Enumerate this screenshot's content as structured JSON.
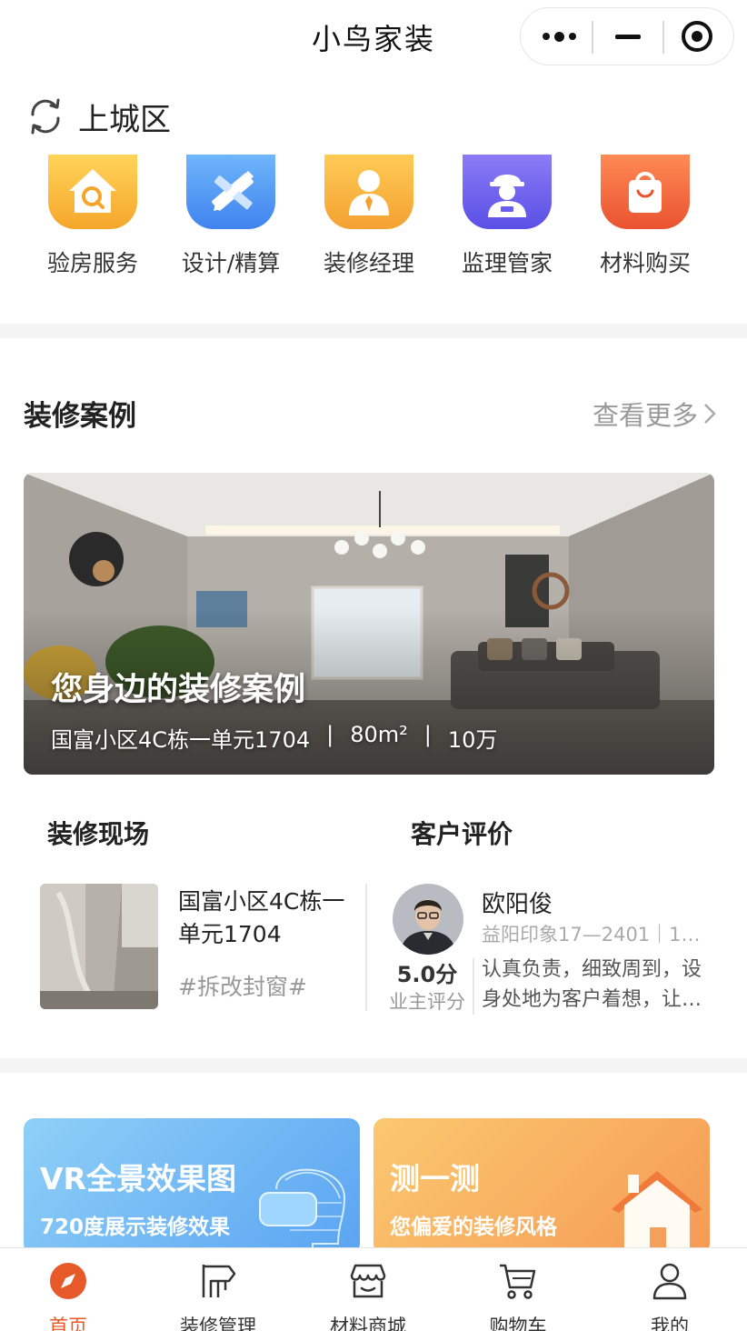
{
  "app": {
    "title": "小鸟家装"
  },
  "location": {
    "district": "上城区"
  },
  "services": [
    {
      "label": "验房服务",
      "icon": "house-search-icon",
      "color": "#f7b738"
    },
    {
      "label": "设计/精算",
      "icon": "ruler-pencil-icon",
      "color": "#4f97f3"
    },
    {
      "label": "装修经理",
      "icon": "manager-icon",
      "color": "#f5a93a"
    },
    {
      "label": "监理管家",
      "icon": "worker-icon",
      "color": "#6a5ef0"
    },
    {
      "label": "材料购买",
      "icon": "shopping-bag-icon",
      "color": "#f2663a"
    }
  ],
  "cases": {
    "section_title": "装修案例",
    "more_label": "查看更多",
    "featured": {
      "title": "您身边的装修案例",
      "community": "国富小区4C栋一单元1704",
      "area": "80m²",
      "budget": "10万",
      "separator": "|"
    }
  },
  "site": {
    "section_title": "装修现场",
    "name": "国富小区4C栋一单元1704",
    "tag": "#拆改封窗#"
  },
  "review": {
    "section_title": "客户评价",
    "name": "欧阳俊",
    "address": "益阳印象17—2401｜1…",
    "score": "5.0分",
    "score_label": "业主评分",
    "text": "认真负责，细致周到，设身处地为客户着想，让…"
  },
  "promos": [
    {
      "title": "VR全景效果图",
      "subtitle": "720度展示装修效果"
    },
    {
      "title": "测一测",
      "subtitle": "您偏爱的装修风格"
    }
  ],
  "tabs": [
    {
      "label": "首页",
      "icon": "compass-icon",
      "active": true
    },
    {
      "label": "装修管理",
      "icon": "paint-roller-icon",
      "active": false
    },
    {
      "label": "材料商城",
      "icon": "store-icon",
      "active": false
    },
    {
      "label": "购物车",
      "icon": "cart-icon",
      "active": false
    },
    {
      "label": "我的",
      "icon": "person-icon",
      "active": false
    }
  ],
  "colors": {
    "accent": "#e8592a",
    "muted": "#999999"
  }
}
